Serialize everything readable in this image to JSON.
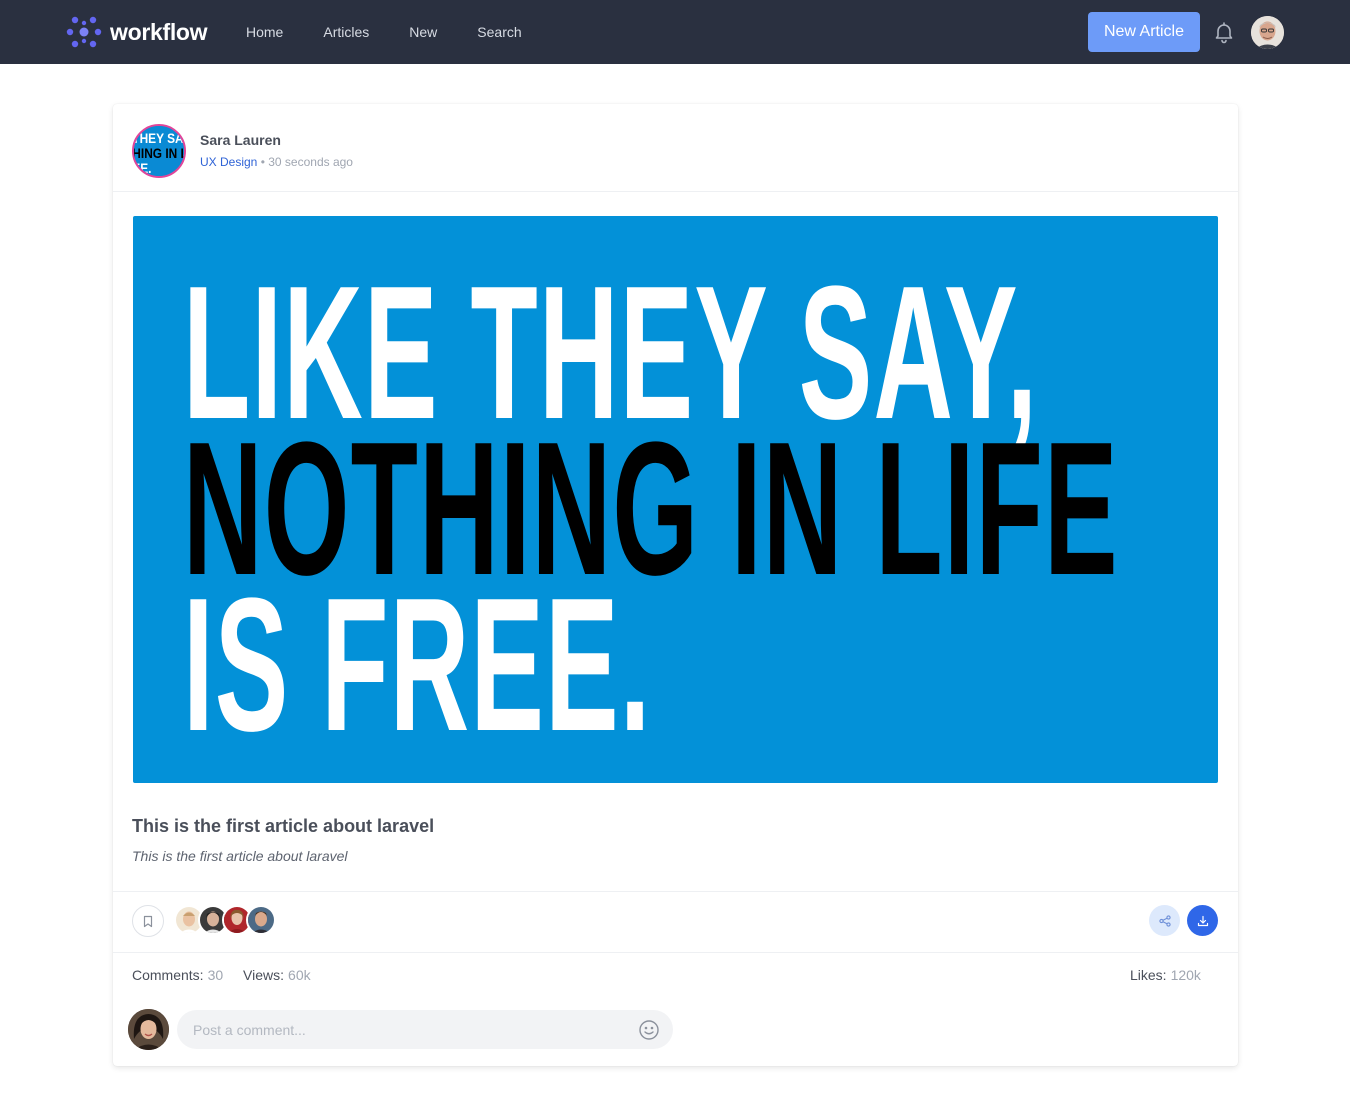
{
  "brand": {
    "name": "workflow",
    "accent": "#6366f1"
  },
  "nav": {
    "links": [
      {
        "label": "Home"
      },
      {
        "label": "Articles"
      },
      {
        "label": "New"
      },
      {
        "label": "Search"
      }
    ],
    "new_article_label": "New Article",
    "notifications_icon": "bell-icon",
    "background": "#2a3040"
  },
  "post": {
    "author": {
      "name": "Sara Lauren",
      "category": "UX Design",
      "separator": "•",
      "time": "30 seconds ago"
    },
    "hero": {
      "background": "#0391d8",
      "lines": [
        "LIKE THEY SAY,",
        "NOTHING IN LIFE",
        "IS FREE."
      ]
    },
    "title": "This is the first article about laravel",
    "excerpt": "This is the first article about laravel",
    "actions": {
      "bookmark_icon": "bookmark-icon",
      "share_icon": "share-icon",
      "download_icon": "download-icon"
    },
    "stats": {
      "comments_label": "Comments:",
      "comments_value": "30",
      "views_label": "Views:",
      "views_value": "60k",
      "likes_label": "Likes:",
      "likes_value": "120k"
    },
    "comment": {
      "placeholder": "Post a comment...",
      "emoji_icon": "smiley-icon"
    }
  }
}
